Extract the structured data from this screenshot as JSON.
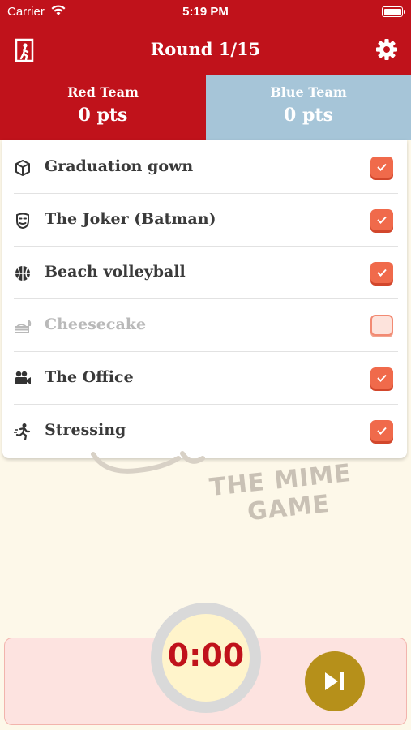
{
  "status_bar": {
    "carrier": "Carrier",
    "time": "5:19 PM"
  },
  "header": {
    "title": "Round 1/15",
    "left_icon": "exit-icon",
    "right_icon": "gear-icon"
  },
  "teams": [
    {
      "name": "Red Team",
      "points": "0 pts",
      "color": "#c0121b"
    },
    {
      "name": "Blue Team",
      "points": "0 pts",
      "color": "#a6c5d8"
    }
  ],
  "words": [
    {
      "icon": "box-icon",
      "label": "Graduation gown",
      "checked": true
    },
    {
      "icon": "mask-icon",
      "label": "The Joker (Batman)",
      "checked": true
    },
    {
      "icon": "ball-icon",
      "label": "Beach volleyball",
      "checked": true
    },
    {
      "icon": "food-icon",
      "label": "Cheesecake",
      "checked": false
    },
    {
      "icon": "camera-icon",
      "label": "The Office",
      "checked": true
    },
    {
      "icon": "runner-icon",
      "label": "Stressing",
      "checked": true
    }
  ],
  "logo": {
    "line1": "THE MIME",
    "line2": "GAME"
  },
  "timer": {
    "value": "0:00"
  },
  "colors": {
    "accent": "#c0121b",
    "check": "#f06a4b",
    "skip": "#b6901a",
    "bottom_bg": "#fde3e0"
  }
}
